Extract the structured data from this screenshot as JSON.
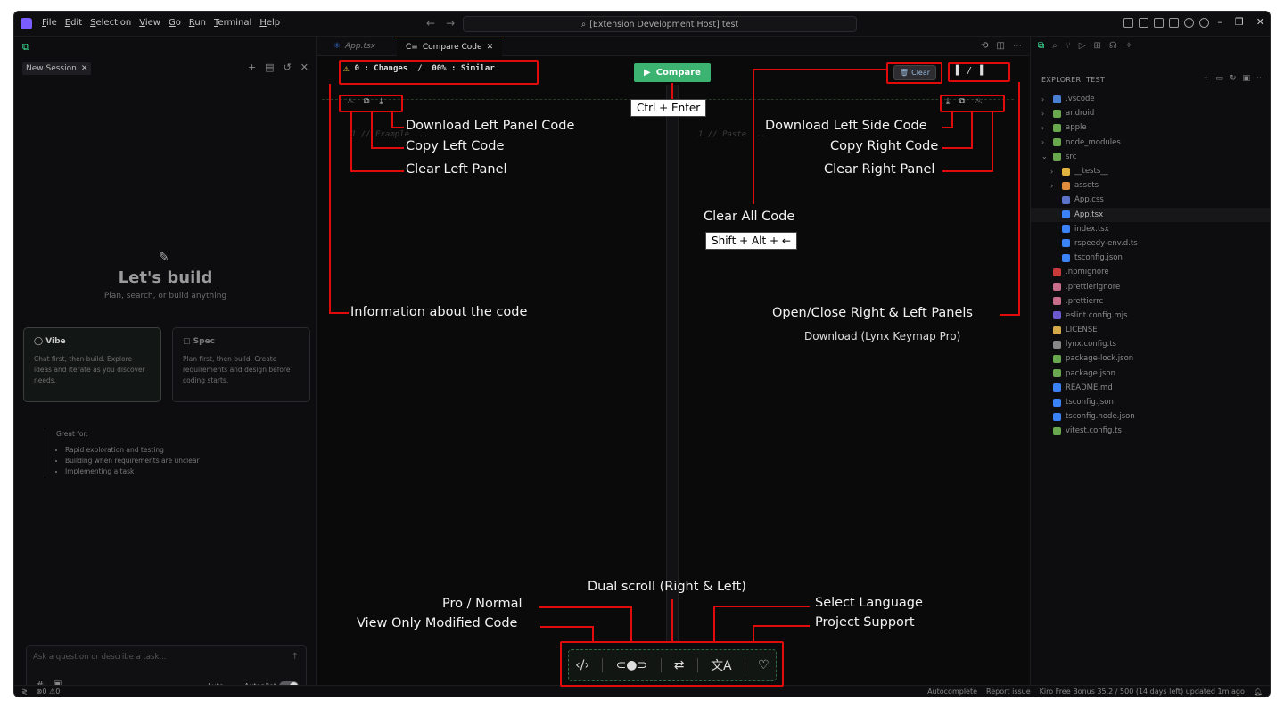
{
  "menubar": {
    "items": [
      "File",
      "Edit",
      "Selection",
      "View",
      "Go",
      "Run",
      "Terminal",
      "Help"
    ],
    "command_center": "[Extension Development Host] test"
  },
  "chat": {
    "tab_label": "New Session",
    "build_title": "Let's build",
    "build_subtitle": "Plan, search, or build anything",
    "vibe": {
      "title": "Vibe",
      "desc": "Chat first, then build. Explore ideas and iterate as you discover needs."
    },
    "spec": {
      "title": "Spec",
      "desc": "Plan first, then build. Create requirements and design before coding starts."
    },
    "great_for": "Great for:",
    "great_items": [
      "Rapid exploration and testing",
      "Building when requirements are unclear",
      "Implementing a task"
    ],
    "input_placeholder": "Ask a question or describe a task...",
    "auto_label": "Auto",
    "autopilot_label": "Autopilot"
  },
  "editor": {
    "tab1": "App.tsx",
    "tab2": "Compare Code",
    "info_badge": "0 : Changes  /  00% : Similar",
    "compare_label": "Compare",
    "clear_label": "Clear",
    "panel_toggle": "▌ / ▐",
    "left_line": "1   // Example ...",
    "right_line": "1   // Paste ..."
  },
  "annotations": {
    "download_left_panel": "Download Left Panel Code",
    "copy_left": "Copy Left Code",
    "clear_left": "Clear Left Panel",
    "ctrl_enter": "Ctrl + Enter",
    "download_left_side": "Download Left Side Code",
    "copy_right": "Copy Right Code",
    "clear_right": "Clear Right Panel",
    "clear_all": "Clear All Code",
    "shift_alt": "Shift + Alt + ←",
    "info_code": "Information about the code",
    "open_close": "Open/Close Right & Left Panels",
    "download_keymap": "Download (Lynx Keymap Pro)",
    "dual_scroll": "Dual scroll (Right & Left)",
    "pro_normal": "Pro / Normal",
    "view_modified": "View Only Modified Code",
    "select_language": "Select Language",
    "project_support": "Project Support"
  },
  "explorer": {
    "title": "EXPLORER: TEST",
    "items": [
      {
        "name": ".vscode",
        "type": "folder",
        "color": "#4a7fd4",
        "indent": 1,
        "chev": "›"
      },
      {
        "name": "android",
        "type": "folder",
        "color": "#6aa84f",
        "indent": 1,
        "chev": "›"
      },
      {
        "name": "apple",
        "type": "folder",
        "color": "#6aa84f",
        "indent": 1,
        "chev": "›"
      },
      {
        "name": "node_modules",
        "type": "folder",
        "color": "#6aa84f",
        "indent": 1,
        "chev": "›"
      },
      {
        "name": "src",
        "type": "folder",
        "color": "#6aa84f",
        "indent": 1,
        "chev": "⌄"
      },
      {
        "name": "__tests__",
        "type": "folder",
        "color": "#e0b341",
        "indent": 2,
        "chev": "›"
      },
      {
        "name": "assets",
        "type": "folder",
        "color": "#e08a3c",
        "indent": 2,
        "chev": "›"
      },
      {
        "name": "App.css",
        "type": "file",
        "color": "#5a73c9",
        "indent": 2,
        "chev": ""
      },
      {
        "name": "App.tsx",
        "type": "file",
        "color": "#3b82f6",
        "indent": 2,
        "chev": "",
        "active": true
      },
      {
        "name": "index.tsx",
        "type": "file",
        "color": "#3b82f6",
        "indent": 2,
        "chev": ""
      },
      {
        "name": "rspeedy-env.d.ts",
        "type": "file",
        "color": "#3b82f6",
        "indent": 2,
        "chev": ""
      },
      {
        "name": "tsconfig.json",
        "type": "file",
        "color": "#3b82f6",
        "indent": 2,
        "chev": ""
      },
      {
        "name": ".npmignore",
        "type": "file",
        "color": "#c83a3a",
        "indent": 1,
        "chev": ""
      },
      {
        "name": ".prettierignore",
        "type": "file",
        "color": "#c86e8a",
        "indent": 1,
        "chev": ""
      },
      {
        "name": ".prettierrc",
        "type": "file",
        "color": "#c86e8a",
        "indent": 1,
        "chev": ""
      },
      {
        "name": "eslint.config.mjs",
        "type": "file",
        "color": "#6a5acd",
        "indent": 1,
        "chev": ""
      },
      {
        "name": "LICENSE",
        "type": "file",
        "color": "#d4a94a",
        "indent": 1,
        "chev": ""
      },
      {
        "name": "lynx.config.ts",
        "type": "file",
        "color": "#888888",
        "indent": 1,
        "chev": ""
      },
      {
        "name": "package-lock.json",
        "type": "file",
        "color": "#6aa84f",
        "indent": 1,
        "chev": ""
      },
      {
        "name": "package.json",
        "type": "file",
        "color": "#6aa84f",
        "indent": 1,
        "chev": ""
      },
      {
        "name": "README.md",
        "type": "file",
        "color": "#3b82f6",
        "indent": 1,
        "chev": ""
      },
      {
        "name": "tsconfig.json",
        "type": "file",
        "color": "#3b82f6",
        "indent": 1,
        "chev": ""
      },
      {
        "name": "tsconfig.node.json",
        "type": "file",
        "color": "#3b82f6",
        "indent": 1,
        "chev": ""
      },
      {
        "name": "vitest.config.ts",
        "type": "file",
        "color": "#6aa84f",
        "indent": 1,
        "chev": ""
      }
    ]
  },
  "status": {
    "problems": "⊗0 ⚠0",
    "autocomplete": "Autocomplete",
    "report": "Report issue",
    "bonus": "Kiro Free Bonus 35.2 / 500 (14 days left) updated 1m ago"
  },
  "colors": {
    "annotation_red": "#e10b0b",
    "compare_green": "#3db371"
  }
}
